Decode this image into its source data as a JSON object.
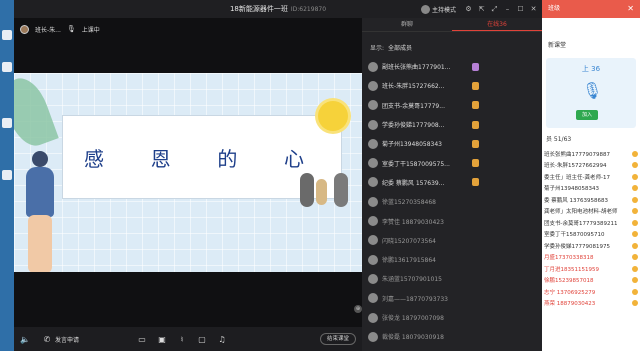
{
  "window": {
    "title": "18新能源器件一班",
    "room_id": "ID:6219870",
    "host_mode_label": "主持模式"
  },
  "video": {
    "host_name": "班长-朱...",
    "status": "上课中",
    "slide_title_chars": [
      "感",
      "恩",
      "的",
      "心"
    ]
  },
  "bottom_bar": {
    "apply_speak": "发言申请",
    "end_class": "结束课堂"
  },
  "panel": {
    "tabs": [
      {
        "label": "群聊"
      },
      {
        "label": "在线36"
      }
    ],
    "show_label": "显示:",
    "show_value": "全部成员",
    "members": [
      {
        "name": "副班长张熊曲1777901..."
      },
      {
        "name": "班长-朱胖15727662..."
      },
      {
        "name": "团支书-余莫哥17779..."
      },
      {
        "name": "学委孙俊娣1777908..."
      },
      {
        "name": "菊子州13948058343"
      },
      {
        "name": "室委丁干1587009575..."
      },
      {
        "name": "纪委 蔡鹏风 157639..."
      },
      {
        "name": "徐蓝15270358468"
      },
      {
        "name": "李赞佳     18879030423"
      },
      {
        "name": "闪晓15207073564"
      },
      {
        "name": "徐鹏13617915864"
      },
      {
        "name": "朱涵蓝15707901015"
      },
      {
        "name": "刘嘉——18770793733"
      },
      {
        "name": "张俊龙 18797007098"
      },
      {
        "name": "裁俊磊 18079030918"
      }
    ]
  },
  "side_window": {
    "header": "班级",
    "section": "新课堂",
    "class_time": "上 36",
    "join": "加入",
    "count": "员 51/63",
    "rows": [
      {
        "text": "班长张熊曲17779079887",
        "red": false
      },
      {
        "text": "班长-朱胖15727662994",
        "red": false
      },
      {
        "text": "委主任」班主任-龚老师-17",
        "red": false
      },
      {
        "text": "菊子州13948058343",
        "red": false
      },
      {
        "text": "委 蔡鹏风 13763958683",
        "red": false
      },
      {
        "text": "龚老师」太阳电池材料-胡老师",
        "red": false
      },
      {
        "text": "团支书-余莫哥17779389211",
        "red": false
      },
      {
        "text": "室委丁干15870095710",
        "red": false
      },
      {
        "text": "学委孙俊娣17779081975",
        "red": false
      },
      {
        "text": "月盛17370338318",
        "red": true
      },
      {
        "text": "丁月进18351151959",
        "red": true
      },
      {
        "text": "徐鹏15239857018",
        "red": true
      },
      {
        "text": "志宁 13706925279",
        "red": true
      },
      {
        "text": "燕荣 18879030423",
        "red": true
      }
    ]
  }
}
